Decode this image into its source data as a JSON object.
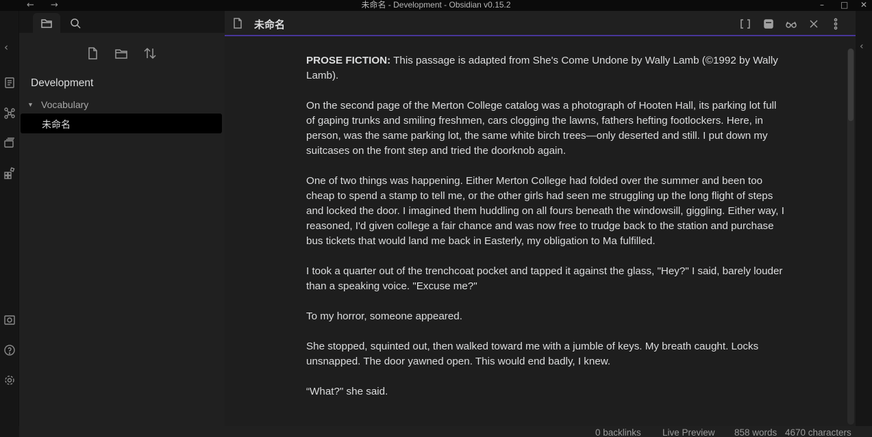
{
  "window": {
    "title": "未命名 - Development - Obsidian v0.15.2",
    "back_icon": "←",
    "forward_icon": "→",
    "minimize": "–",
    "maximize": "□",
    "close": "✕"
  },
  "ribbon": {
    "icons": [
      "collapse-left-icon",
      "quick-switcher-icon",
      "graph-view-icon",
      "slides-icon",
      "canvas-blocks-icon",
      "vault-switch-icon",
      "help-icon",
      "settings-icon"
    ]
  },
  "sidebar": {
    "tabs": [
      "file-explorer-icon",
      "search-icon"
    ],
    "actions": [
      "new-note-icon",
      "new-folder-icon",
      "sort-icon"
    ],
    "vault_name": "Development",
    "folder": {
      "name": "Vocabulary",
      "caret": "▼"
    },
    "file": {
      "name": "未命名"
    }
  },
  "main": {
    "view_title": "未命名",
    "actions": [
      "edit-source-icon",
      "bookmark-icon",
      "reading-view-icon",
      "close-icon",
      "more-options-icon"
    ],
    "content": {
      "lead_label": "PROSE FICTION:",
      "lead_text": " This passage is adapted from She's Come Undone by Wally Lamb (©1992 by Wally Lamb).",
      "paragraphs": [
        "On the second page of the Merton College catalog was a photograph of Hooten Hall, its parking lot full of gaping trunks and smiling freshmen, cars clogging the lawns, fathers hefting footlockers. Here, in person, was the same parking lot, the same white birch trees—only deserted and still. I put down my suitcases on the front step and tried the doorknob again.",
        "One of two things was happening. Either Merton College had folded over the summer and been too cheap to spend a stamp to tell me, or the other girls had seen me struggling up the long flight of steps and locked the door. I imagined them huddling on all fours beneath the windowsill, giggling. Either way, I reasoned, I'd given college a fair chance and was now free to trudge back to the station and purchase bus tickets that would land me back in Easterly, my obligation to Ma fulfilled.",
        "I took a quarter out of the trenchcoat pocket and tapped it against the glass, \"Hey?\" I said, barely louder than a speaking voice. \"Excuse me?\"",
        "To my horror, someone appeared.",
        "She stopped, squinted out, then walked toward me with a jumble of keys. My breath caught. Locks unsnapped. The door yawned open. This would end badly, I knew.",
        "“What?\" she said."
      ]
    }
  },
  "statusbar": {
    "backlinks": "0 backlinks",
    "mode": "Live Preview",
    "words": "858 words",
    "characters": "4670 characters"
  },
  "colors": {
    "accent": "#483699",
    "background": "#1e1e1e",
    "sidebar": "#202020",
    "ribbon": "#161616"
  }
}
